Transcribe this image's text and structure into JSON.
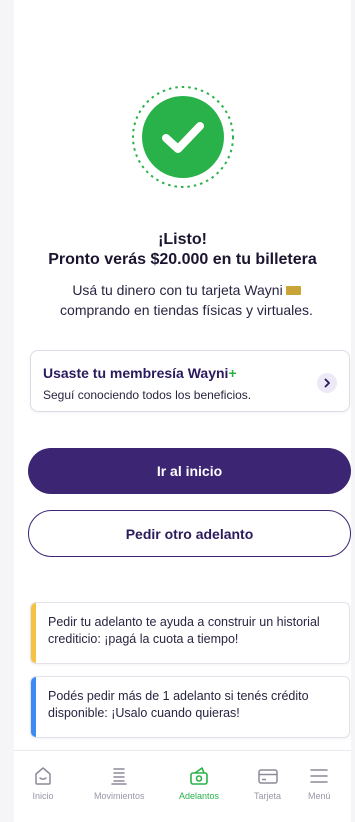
{
  "status": {
    "title": "¡Listo!",
    "subtitle": "Pronto verás $20.000 en tu billetera",
    "description_line1": "Usá tu dinero con tu tarjeta Wayni",
    "description_line2": "comprando en tiendas físicas y virtuales."
  },
  "membership": {
    "title": "Usaste tu membresía Wayni",
    "plus": "+",
    "subtitle": "Seguí conociendo todos los beneficios."
  },
  "buttons": {
    "primary": "Ir al inicio",
    "secondary": "Pedir otro adelanto"
  },
  "tips": [
    {
      "text": "Pedir tu adelanto te ayuda a construir un historial crediticio: ¡pagá la cuota a tiempo!",
      "accent": "#f5c242"
    },
    {
      "text": "Podés pedir más de 1 adelanto si tenés crédito disponible: ¡Usalo cuando quieras!",
      "accent": "#3d8bf2"
    }
  ],
  "nav": {
    "items": [
      {
        "label": "Inicio",
        "icon": "home-icon",
        "active": false
      },
      {
        "label": "Movimientos",
        "icon": "list-icon",
        "active": false
      },
      {
        "label": "Adelantos",
        "icon": "cash-icon",
        "active": true
      },
      {
        "label": "Tarjeta",
        "icon": "card-icon",
        "active": false
      },
      {
        "label": "Menú",
        "icon": "menu-icon",
        "active": false
      }
    ]
  },
  "colors": {
    "brand_purple": "#3c2573",
    "success_green": "#2ab24a",
    "tip_yellow": "#f5c242",
    "tip_blue": "#3d8bf2"
  }
}
